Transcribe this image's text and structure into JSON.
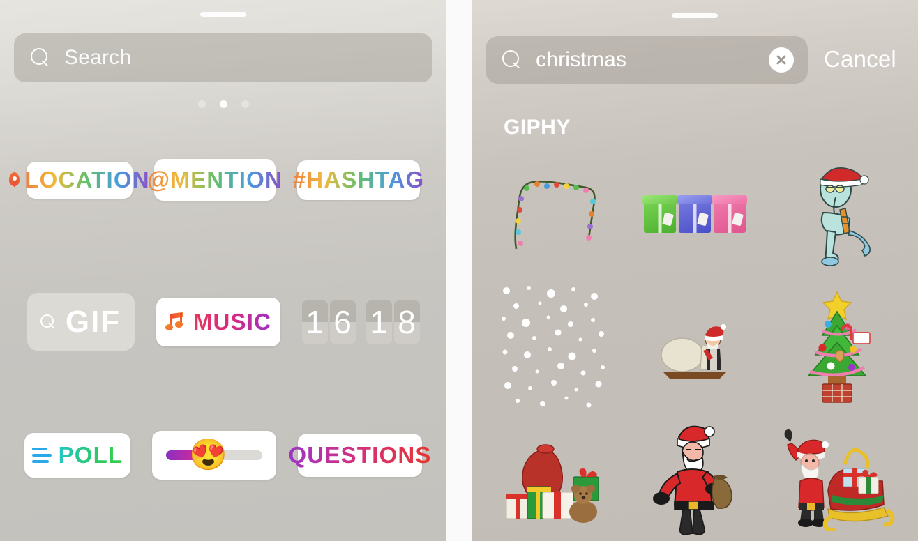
{
  "left_panel": {
    "handle": "drag-handle",
    "search": {
      "placeholder": "Search",
      "icon": "search-icon"
    },
    "pagination": {
      "total": 3,
      "active_index": 1
    },
    "stickers": [
      {
        "id": "location",
        "label": "LOCATION",
        "icon": "map-pin-icon",
        "style": "white-chip",
        "gradient": "rainbow"
      },
      {
        "id": "mention",
        "label": "@MENTION",
        "style": "white-chip",
        "gradient": "rainbow"
      },
      {
        "id": "hashtag",
        "label": "#HASHTAG",
        "style": "white-chip",
        "gradient": "rainbow"
      },
      {
        "id": "gif",
        "label": "GIF",
        "icon": "search-icon",
        "style": "gray-chip"
      },
      {
        "id": "music",
        "label": "MUSIC",
        "icon": "music-note-icon",
        "style": "white-chip",
        "gradient": "music"
      },
      {
        "id": "countdown",
        "label": "16 18",
        "digits": [
          "1",
          "6",
          "1",
          "8"
        ],
        "style": "flip-clock"
      },
      {
        "id": "poll",
        "label": "POLL",
        "icon": "poll-bars-icon",
        "style": "white-chip",
        "gradient": "poll"
      },
      {
        "id": "emoji-slider",
        "label": "",
        "emoji": "😍",
        "style": "white-chip",
        "fill_percent": 40
      },
      {
        "id": "questions",
        "label": "QUESTIONS",
        "style": "white-chip",
        "gradient": "questions"
      }
    ],
    "colors": {
      "rainbow_start": "#f0803c",
      "rainbow_end": "#8a4fc8",
      "music_start": "#e8365d",
      "music_end": "#9b2fc9",
      "poll_start": "#22c7c5",
      "poll_end": "#36d045",
      "questions_start": "#9b35c6",
      "questions_end": "#e8352e",
      "poll_bars": "#2aa8e8",
      "slider_fill_start": "#8a2fc2",
      "slider_fill_end": "#e02a8e",
      "slider_track": "#dcdad6"
    }
  },
  "right_panel": {
    "handle": "drag-handle",
    "search": {
      "value": "christmas",
      "icon": "search-icon",
      "clear_icon": "close-circle-icon"
    },
    "cancel_label": "Cancel",
    "section_title": "GIPHY",
    "results": [
      {
        "id": "christmas-lights",
        "name": "christmas-lights-string",
        "emoji": ""
      },
      {
        "id": "gift-boxes",
        "name": "three-gift-boxes",
        "emoji": ""
      },
      {
        "id": "squidward-santa",
        "name": "squidward-in-santa-hat",
        "emoji": ""
      },
      {
        "id": "falling-snow",
        "name": "falling-snow-overlay",
        "emoji": ""
      },
      {
        "id": "santa-sack-push",
        "name": "santa-pushing-sack",
        "emoji": ""
      },
      {
        "id": "christmas-tree",
        "name": "decorated-christmas-tree",
        "emoji": "🎄"
      },
      {
        "id": "gift-pile",
        "name": "gift-sack-with-presents-and-teddy",
        "emoji": "🎁"
      },
      {
        "id": "walking-santa",
        "name": "santa-walking-with-sack",
        "emoji": "🎅"
      },
      {
        "id": "santa-sleigh",
        "name": "santa-waving-beside-sleigh",
        "emoji": "🛷"
      }
    ]
  }
}
